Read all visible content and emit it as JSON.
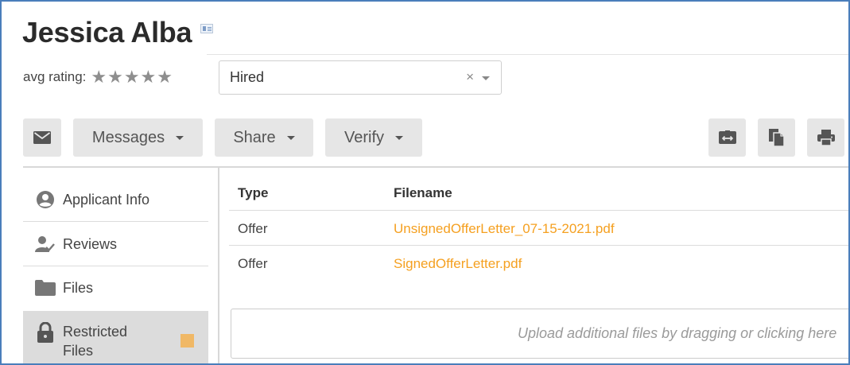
{
  "candidate": {
    "name": "Jessica Alba",
    "vcard_icon": "vcard-icon"
  },
  "rating": {
    "label": "avg rating:",
    "stars": "★★★★★",
    "value": 0,
    "max": 5
  },
  "status": {
    "selected": "Hired",
    "clear_glyph": "×"
  },
  "toolbar": {
    "mail_icon": "envelope-icon",
    "messages_label": "Messages",
    "share_label": "Share",
    "verify_label": "Verify",
    "expand_icon": "expand-horizontal-icon",
    "copy_icon": "copy-document-icon",
    "print_icon": "printer-icon"
  },
  "sidebar": {
    "items": [
      {
        "label": "Applicant Info",
        "icon": "user-circle-icon"
      },
      {
        "label": "Reviews",
        "icon": "user-check-icon"
      },
      {
        "label": "Files",
        "icon": "folder-icon"
      },
      {
        "label": "Restricted Files",
        "icon": "lock-icon",
        "active": true
      }
    ]
  },
  "files_table": {
    "headers": [
      "Type",
      "Filename"
    ],
    "rows": [
      {
        "type": "Offer",
        "filename": "UnsignedOfferLetter_07-15-2021.pdf"
      },
      {
        "type": "Offer",
        "filename": "SignedOfferLetter.pdf"
      }
    ]
  },
  "upload": {
    "placeholder": "Upload additional files by dragging or clicking here"
  },
  "colors": {
    "link": "#f5a020",
    "marker": "#f0b866",
    "button_bg": "#e6e6e6",
    "frame": "#4a7ebb"
  }
}
